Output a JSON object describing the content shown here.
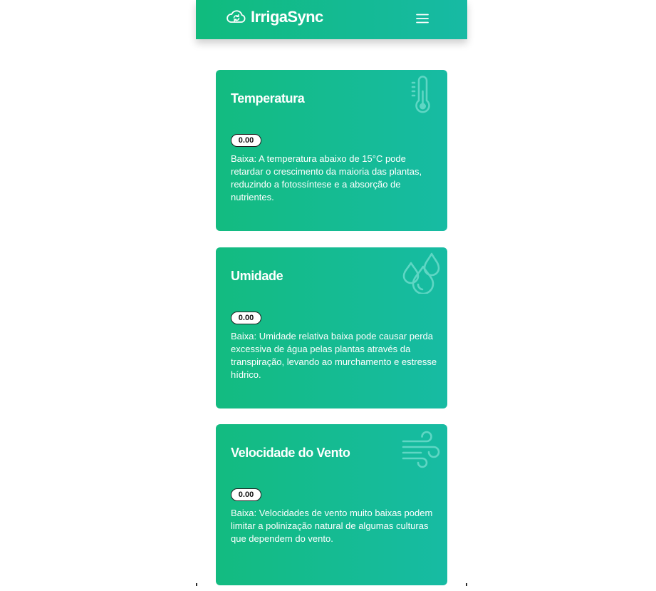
{
  "header": {
    "brand_name": "IrrigaSync",
    "brand_icon": "cloud-sync-icon",
    "menu_icon": "hamburger-menu-icon",
    "gradient": [
      "#10bb7d",
      "#17baa4"
    ]
  },
  "cards": [
    {
      "title": "Temperatura",
      "icon": "thermometer-icon",
      "value": "0.00",
      "description": "Baixa: A temperatura abaixo de 15°C pode retardar o crescimento da maioria das plantas, reduzindo a fotossíntese e a absorção de nutrientes."
    },
    {
      "title": "Umidade",
      "icon": "water-drops-icon",
      "value": "0.00",
      "description": "Baixa: Umidade relativa baixa pode causar perda excessiva de água pelas plantas através da transpiração, levando ao murchamento e estresse hídrico."
    },
    {
      "title": "Velocidade do Vento",
      "icon": "wind-icon",
      "value": "0.00",
      "description": "Baixa: Velocidades de vento muito baixas podem limitar a polinização natural de algumas culturas que dependem do vento."
    }
  ],
  "colors": {
    "card_gradient_start": "#13bb80",
    "card_gradient_end": "#17bba3",
    "icon_tint": "#5fd6c4"
  }
}
